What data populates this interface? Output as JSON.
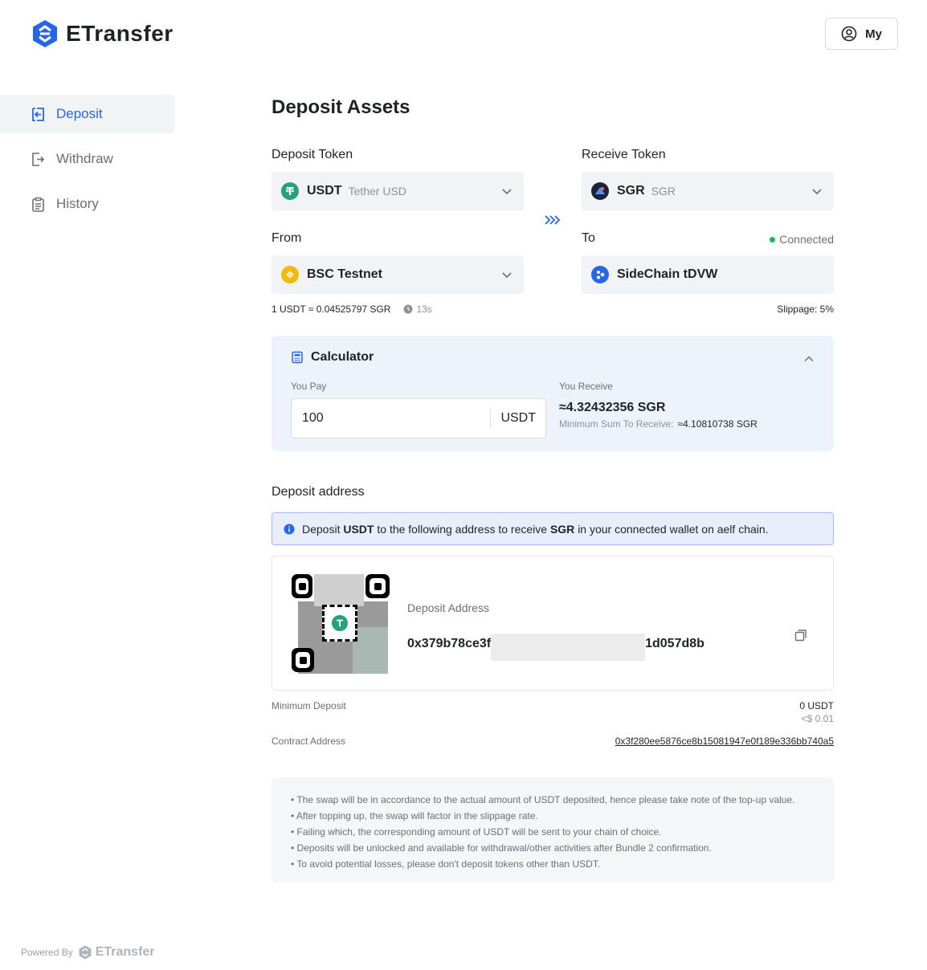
{
  "header": {
    "brand": "ETransfer",
    "my_label": "My"
  },
  "sidebar": {
    "items": [
      {
        "label": "Deposit",
        "icon": "deposit-icon",
        "active": true
      },
      {
        "label": "Withdraw",
        "icon": "withdraw-icon",
        "active": false
      },
      {
        "label": "History",
        "icon": "history-icon",
        "active": false
      }
    ]
  },
  "footer": {
    "powered_by": "Powered By",
    "brand": "ETransfer"
  },
  "main": {
    "title": "Deposit Assets",
    "deposit_token": {
      "label": "Deposit Token",
      "symbol": "USDT",
      "name": "Tether USD"
    },
    "receive_token": {
      "label": "Receive Token",
      "symbol": "SGR",
      "name": "SGR"
    },
    "from": {
      "label": "From",
      "network": "BSC Testnet"
    },
    "to": {
      "label": "To",
      "status": "Connected",
      "network": "SideChain tDVW"
    },
    "rate": "1 USDT ≈ 0.04525797 SGR",
    "rate_time": "13s",
    "slippage": "Slippage: 5%",
    "calculator": {
      "title": "Calculator",
      "you_pay_label": "You Pay",
      "you_pay_value": "100",
      "you_pay_unit": "USDT",
      "you_receive_label": "You Receive",
      "you_receive_value": "≈4.32432356 SGR",
      "min_receive_label": "Minimum Sum To Receive:",
      "min_receive_value": "≈4.10810738 SGR"
    },
    "deposit_address": {
      "section_title": "Deposit address",
      "info_prefix": "Deposit",
      "info_token": "USDT",
      "info_middle": "to the following address to receive",
      "info_receive": "SGR",
      "info_suffix": "in your connected wallet on aelf chain.",
      "address_label": "Deposit Address",
      "address_start": "0x379b78ce3f",
      "address_end": "1d057d8b"
    },
    "minimum_deposit": {
      "label": "Minimum Deposit",
      "value": "0 USDT",
      "usd": "<$ 0.01"
    },
    "contract_address": {
      "label": "Contract Address",
      "value": "0x3f280ee5876ce8b15081947e0f189e336bb740a5"
    },
    "notes": [
      "• The swap will be in accordance to the actual amount of USDT deposited, hence please take note of the top-up value.",
      "• After topping up, the swap will factor in the slippage rate.",
      "• Failing which, the corresponding amount of USDT will be sent to your chain of choice.",
      "• Deposits will be unlocked and available for withdrawal/other activities after Bundle 2 confirmation.",
      "• To avoid potential losses, please don't deposit tokens other than USDT."
    ]
  },
  "colors": {
    "accent": "#2866e8",
    "usdt": "#26a17b",
    "bnb": "#f0b90b",
    "connected": "#1db954"
  }
}
